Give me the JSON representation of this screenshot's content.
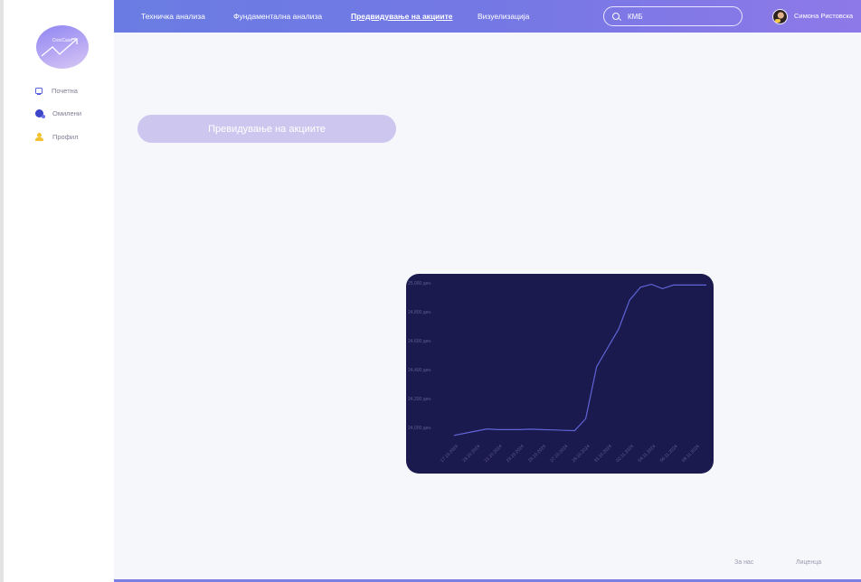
{
  "brand": {
    "logo_text": "CrocCase"
  },
  "sidebar": {
    "items": [
      {
        "label": "Почетна",
        "icon": "monitor-icon"
      },
      {
        "label": "Омилени",
        "icon": "favorites-icon"
      },
      {
        "label": "Профил",
        "icon": "user-icon"
      }
    ]
  },
  "nav": {
    "items": [
      {
        "label": "Техничка анализа"
      },
      {
        "label": "Фундаментална анализа"
      },
      {
        "label": "Предвидување на акциите",
        "active": true
      },
      {
        "label": "Визуелизација"
      }
    ]
  },
  "search": {
    "value": "КМБ",
    "icon": "search-icon"
  },
  "user": {
    "name": "Симона Ристовска"
  },
  "main": {
    "predict_button": "Превидување на акциите"
  },
  "chart_data": {
    "type": "line",
    "x": [
      "17.10.2024",
      "18.10.2024",
      "19.10.2024",
      "20.10.2024",
      "21.10.2024",
      "22.10.2024",
      "23.10.2024",
      "24.10.2024",
      "25.10.2024",
      "26.10.2024",
      "27.10.2024",
      "28.10.2024",
      "29.10.2024",
      "30.10.2024",
      "31.10.2024",
      "01.11.2024",
      "02.11.2024",
      "03.11.2024",
      "04.11.2024",
      "05.11.2024",
      "06.11.2024",
      "07.11.2024",
      "08.11.2024",
      "09.11.2024"
    ],
    "x_tick_labels": [
      "17.10.2024",
      "19.10.2024",
      "21.10.2024",
      "23.10.2024",
      "25.10.2024",
      "27.10.2024",
      "29.10.2024",
      "31.10.2024",
      "02.11.2024",
      "04.11.2024",
      "06.11.2024",
      "08.11.2024"
    ],
    "series": [
      {
        "values": [
          23945,
          23960,
          23975,
          23990,
          23985,
          23985,
          23985,
          23988,
          23985,
          23983,
          23980,
          23978,
          24060,
          24420,
          24550,
          24680,
          24880,
          24970,
          24990,
          24960,
          24985,
          24985,
          24985,
          24985
        ],
        "color": "#5f64d6"
      }
    ],
    "y_tick_labels": [
      "24,000 ден.",
      "24,200 ден.",
      "24,400 ден.",
      "24,600 ден.",
      "24,800 ден.",
      "25,000 ден."
    ],
    "ylim": [
      23940,
      25000
    ],
    "grid": false
  },
  "footer": {
    "about": "За нас",
    "license": "Лиценца"
  }
}
